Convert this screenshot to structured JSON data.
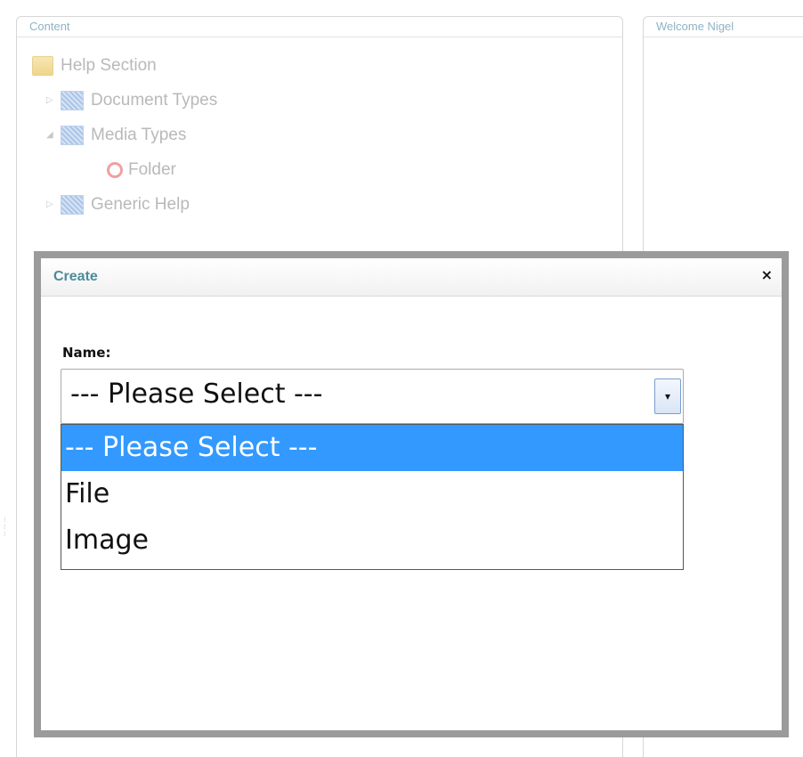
{
  "panels": {
    "content_title": "Content",
    "welcome_title": "Welcome Nigel"
  },
  "tree": {
    "items": [
      {
        "label": "Help Section",
        "icon": "folder-icon"
      },
      {
        "label": "Document Types",
        "icon": "document-type-icon",
        "expander": "▷"
      },
      {
        "label": "Media Types",
        "icon": "document-type-icon",
        "expander": "◢"
      },
      {
        "label": "Folder",
        "icon": "media-folder-icon"
      },
      {
        "label": "Generic Help",
        "icon": "document-type-icon",
        "expander": "▷"
      }
    ]
  },
  "modal": {
    "title": "Create",
    "close_glyph": "×",
    "name_label": "Name:",
    "select": {
      "value": "--- Please Select ---",
      "arrow_glyph": "▾",
      "options": [
        "--- Please Select ---",
        "File",
        "Image"
      ],
      "selected_index": 0,
      "highlight_color": "#3399ff"
    }
  }
}
